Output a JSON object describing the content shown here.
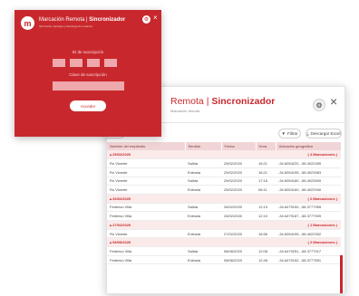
{
  "login": {
    "title_prefix": "Marcación Remota",
    "title_sep": "|",
    "title_strong": "Sincronizador",
    "subtitle": "Sincroniza marcajes y descarga de usuarios",
    "user_label": "ID de suscripción",
    "key_label": "Clave de suscripción",
    "button_label": "Acceder",
    "close_glyph": "×"
  },
  "main": {
    "title_prefix": "Remota",
    "title_sep": "|",
    "title_strong": "Sincronizador",
    "subtitle": "Marcación remota",
    "close_glyph": "×",
    "toolbar": {
      "left_label": "ninar",
      "filter_label": "Filtrar",
      "export_label": "Descargar Excel"
    },
    "columns": [
      "Nombre del empleado",
      "Sentido",
      "Fecha",
      "Hora",
      "Ubicación geográfica"
    ],
    "rows": [
      {
        "type": "group",
        "date": "25/02/2020",
        "marcaciones": "( 4 Marcaciones )"
      },
      {
        "type": "row",
        "name": "Ro Vicente",
        "dir": "Salida",
        "date": "25/02/2020",
        "time": "16:21",
        "loc": "-34.6054220, -58.4022459"
      },
      {
        "type": "row",
        "name": "Ro Vicente",
        "dir": "Entrada",
        "date": "25/02/2020",
        "time": "16:21",
        "loc": "-34.6054195, -58.4023963"
      },
      {
        "type": "row",
        "name": "Ro Vicente",
        "dir": "Salida",
        "date": "25/02/2020",
        "time": "17:16",
        "loc": "-34.6054180, -58.4022609"
      },
      {
        "type": "row",
        "name": "Ro Vicente",
        "dir": "Entrada",
        "date": "25/02/2020",
        "time": "08:11",
        "loc": "-34.6054160, -58.4022940"
      },
      {
        "type": "group",
        "date": "26/02/2020",
        "marcaciones": "( 2 Marcaciones )"
      },
      {
        "type": "row",
        "name": "Federico Villa",
        "dir": "Salida",
        "date": "26/02/2020",
        "time": "12:13",
        "loc": "-34.6479150, -58.3777955"
      },
      {
        "type": "row",
        "name": "Federico Villa",
        "dir": "Entrada",
        "date": "26/02/2020",
        "time": "12:10",
        "loc": "-34.6479187, -58.3777909"
      },
      {
        "type": "group",
        "date": "27/02/2020",
        "marcaciones": "( 1 Marcaciones )"
      },
      {
        "type": "row",
        "name": "Ro Vicente",
        "dir": "Entrada",
        "date": "27/02/2020",
        "time": "16:56",
        "loc": "-34.6054195, -58.4022302"
      },
      {
        "type": "group",
        "date": "08/06/2020",
        "marcaciones": "( 2 Marcaciones )"
      },
      {
        "type": "row",
        "name": "Federico Villa",
        "dir": "Salida",
        "date": "08/06/2020",
        "time": "12:08",
        "loc": "-34.6479251, -58.3777917"
      },
      {
        "type": "row",
        "name": "Federico Villa",
        "dir": "Entrada",
        "date": "08/06/2020",
        "time": "12:48",
        "loc": "-34.6479152, -58.3777891"
      }
    ]
  }
}
